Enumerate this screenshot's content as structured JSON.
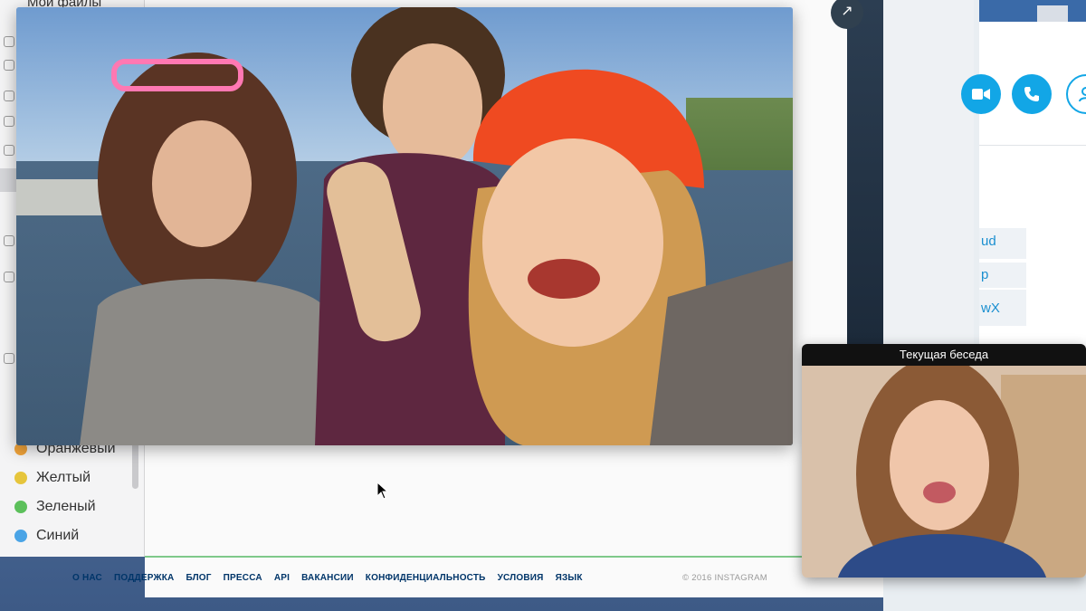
{
  "finder": {
    "favorites_label": "Мои файлы",
    "tags": [
      {
        "label": "Оранжевый",
        "color": "#f0a33a"
      },
      {
        "label": "Желтый",
        "color": "#e6c53c"
      },
      {
        "label": "Зеленый",
        "color": "#5cc05b"
      },
      {
        "label": "Синий",
        "color": "#4aa4e6"
      }
    ]
  },
  "instagram": {
    "footer_links": [
      "О НАС",
      "ПОДДЕРЖКА",
      "БЛОГ",
      "ПРЕССА",
      "API",
      "ВАКАНСИИ",
      "КОНФИДЕНЦИАЛЬНОСТЬ",
      "УСЛОВИЯ",
      "ЯЗЫК"
    ],
    "copyright": "© 2016 INSTAGRAM"
  },
  "skype": {
    "chips": [
      "ud",
      "p",
      "wX"
    ],
    "accent": "#12a6e6",
    "call_buttons": [
      "video-call-icon",
      "phone-icon",
      "add-contact-icon"
    ]
  },
  "video_call": {
    "thumbnail_title": "Текущая беседа"
  },
  "icons": {
    "expand": "expand-arrow-icon",
    "cursor": "mouse-pointer-icon"
  }
}
